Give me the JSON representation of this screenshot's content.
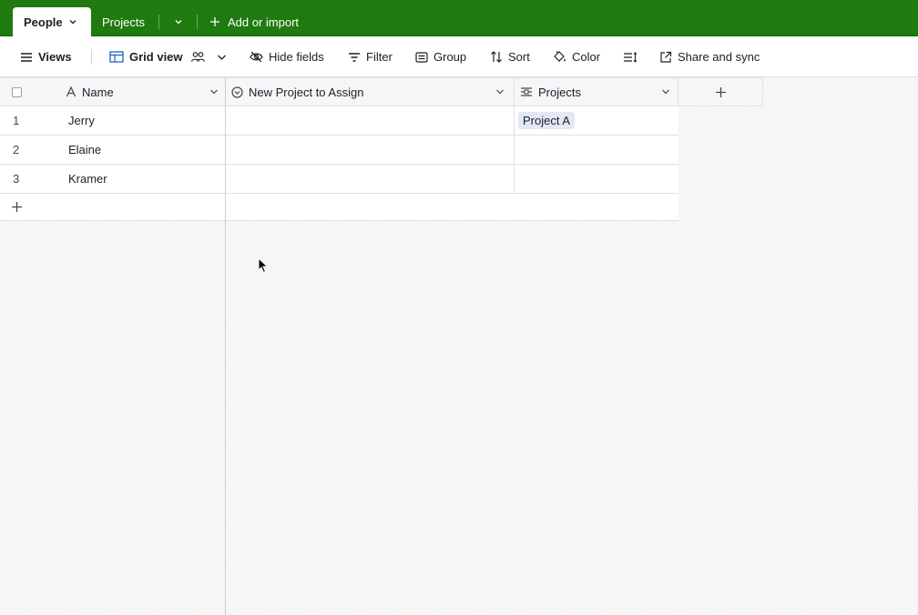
{
  "tabs": [
    {
      "label": "People",
      "active": true
    },
    {
      "label": "Projects",
      "active": false
    }
  ],
  "add_or_import_label": "Add or import",
  "toolbar": {
    "views_label": "Views",
    "grid_view_label": "Grid view",
    "hide_fields_label": "Hide fields",
    "filter_label": "Filter",
    "group_label": "Group",
    "sort_label": "Sort",
    "color_label": "Color",
    "share_label": "Share and sync"
  },
  "columns": [
    {
      "label": "Name",
      "icon": "text-field-icon"
    },
    {
      "label": "New Project to Assign",
      "icon": "single-select-icon"
    },
    {
      "label": "Projects",
      "icon": "linked-record-icon"
    }
  ],
  "rows": [
    {
      "num": "1",
      "name": "Jerry",
      "new_project": "",
      "projects": [
        "Project A"
      ]
    },
    {
      "num": "2",
      "name": "Elaine",
      "new_project": "",
      "projects": []
    },
    {
      "num": "3",
      "name": "Kramer",
      "new_project": "",
      "projects": []
    }
  ],
  "colors": {
    "header_green": "#1f7a10",
    "chip_bg": "#e2e8f4"
  }
}
